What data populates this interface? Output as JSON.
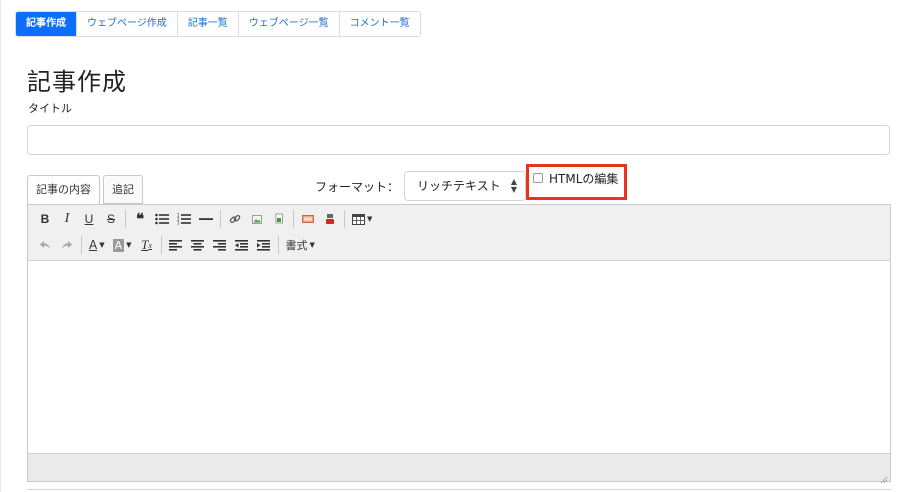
{
  "nav": {
    "items": [
      {
        "label": "記事作成",
        "active": true
      },
      {
        "label": "ウェブページ作成",
        "active": false
      },
      {
        "label": "記事一覧",
        "active": false
      },
      {
        "label": "ウェブページ一覧",
        "active": false
      },
      {
        "label": "コメント一覧",
        "active": false
      }
    ]
  },
  "page": {
    "title": "記事作成",
    "title_field_label": "タイトル",
    "title_value": ""
  },
  "editor_tabs": {
    "content": "記事の内容",
    "append": "追記"
  },
  "format": {
    "label": "フォーマット：",
    "selected": "リッチテキスト"
  },
  "html_edit": {
    "label": "HTMLの編集",
    "checked": false
  },
  "toolbar": {
    "row1": [
      "bold-icon",
      "italic-icon",
      "underline-icon",
      "strikethrough-icon",
      "blockquote-icon",
      "bulleted-list-icon",
      "numbered-list-icon",
      "horizontal-rule-icon",
      "link-icon",
      "image-icon",
      "insert-file-icon",
      "flash-icon",
      "youtube-icon",
      "table-icon"
    ],
    "row2": [
      "undo-icon",
      "redo-icon",
      "text-color-icon",
      "background-color-icon",
      "remove-format-icon",
      "align-left-icon",
      "align-center-icon",
      "align-right-icon",
      "outdent-icon",
      "indent-icon"
    ],
    "styles_label": "書式"
  },
  "colors": {
    "accent": "#0d6efd",
    "highlight_border": "#e8341c"
  }
}
